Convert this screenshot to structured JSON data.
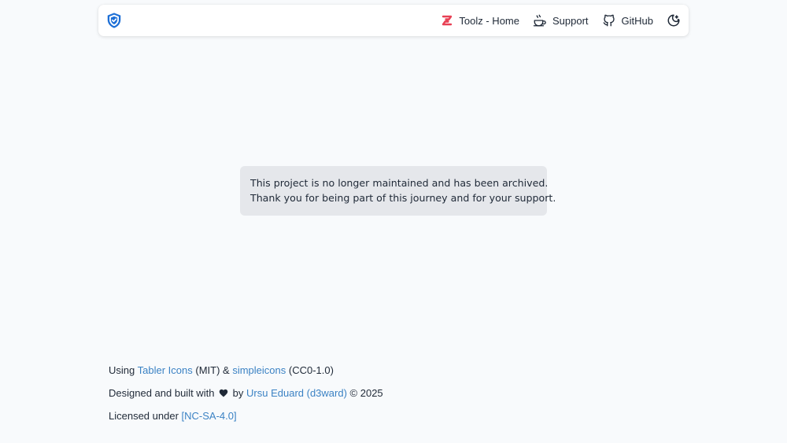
{
  "navbar": {
    "logo_icon": "shield-logo-icon",
    "links": [
      {
        "label": "Toolz - Home",
        "icon": "toolz-logo-icon"
      },
      {
        "label": "Support",
        "icon": "coffee-cup-icon"
      },
      {
        "label": "GitHub",
        "icon": "github-icon"
      }
    ],
    "theme_toggle_icon": "moon-icon"
  },
  "notice": {
    "line1": "This project is no longer maintained and has been archived.",
    "line2": "Thank you for being part of this journey and for your support."
  },
  "footer": {
    "line1": {
      "prefix": "Using",
      "tabler_link": "Tabler Icons",
      "tabler_license": "(MIT) &",
      "simpleicons_link": "simpleicons",
      "simpleicons_license": "(CC0-1.0)"
    },
    "line2": {
      "prefix": "Designed and built with",
      "by": "by",
      "author_link": "Ursu Eduard (d3ward)",
      "copyright": "© 2025"
    },
    "line3": {
      "prefix": "Licensed under",
      "license_link": "[NC-SA-4.0]"
    }
  },
  "colors": {
    "background": "#f8fafc",
    "link": "#3b82c4",
    "logo_blue": "#1d6fd6",
    "toolz_red": "#e84155",
    "notice_bg": "#e5e7eb"
  }
}
